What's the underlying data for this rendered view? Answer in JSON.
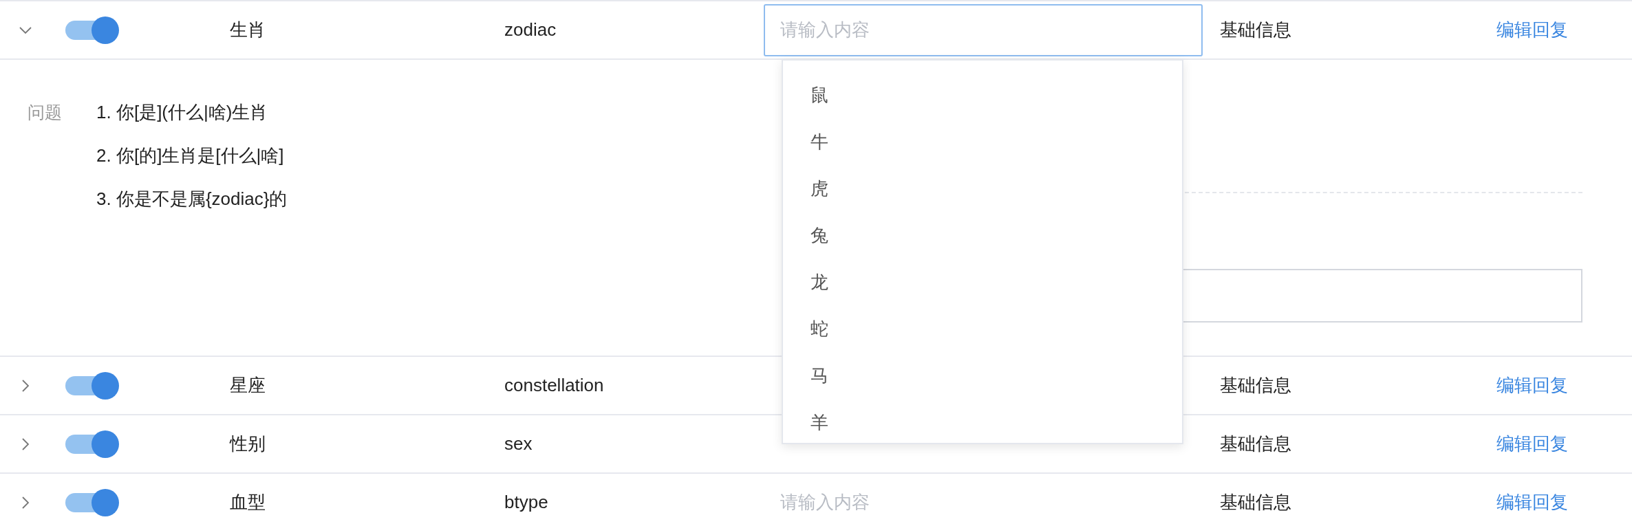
{
  "rows": [
    {
      "expanded": true,
      "enabled": true,
      "name": "生肖",
      "key": "zodiac",
      "input": {
        "placeholder": "请输入内容",
        "focused": true
      },
      "category": "基础信息",
      "action": "编辑回复",
      "details": {
        "label": "问题",
        "questions": [
          "1. 你[是](什么|啥)生肖",
          "2. 你[的]生肖是[什么|啥]",
          "3. 你是不是属{zodiac}的"
        ]
      }
    },
    {
      "expanded": false,
      "enabled": true,
      "name": "星座",
      "key": "constellation",
      "input": {
        "focused": false
      },
      "category": "基础信息",
      "action": "编辑回复"
    },
    {
      "expanded": false,
      "enabled": true,
      "name": "性别",
      "key": "sex",
      "input": {
        "focused": false
      },
      "category": "基础信息",
      "action": "编辑回复"
    },
    {
      "expanded": false,
      "enabled": true,
      "name": "血型",
      "key": "btype",
      "input": {
        "placeholder": "请输入内容",
        "focused": false
      },
      "category": "基础信息",
      "action": "编辑回复"
    }
  ],
  "dropdown": {
    "options": [
      {
        "label": "鼠",
        "selected": false
      },
      {
        "label": "牛",
        "selected": false
      },
      {
        "label": "虎",
        "selected": false
      },
      {
        "label": "兔",
        "selected": false
      },
      {
        "label": "龙",
        "selected": false
      },
      {
        "label": "蛇",
        "selected": false
      },
      {
        "label": "马",
        "selected": false
      },
      {
        "label": "羊",
        "selected": false
      }
    ]
  }
}
